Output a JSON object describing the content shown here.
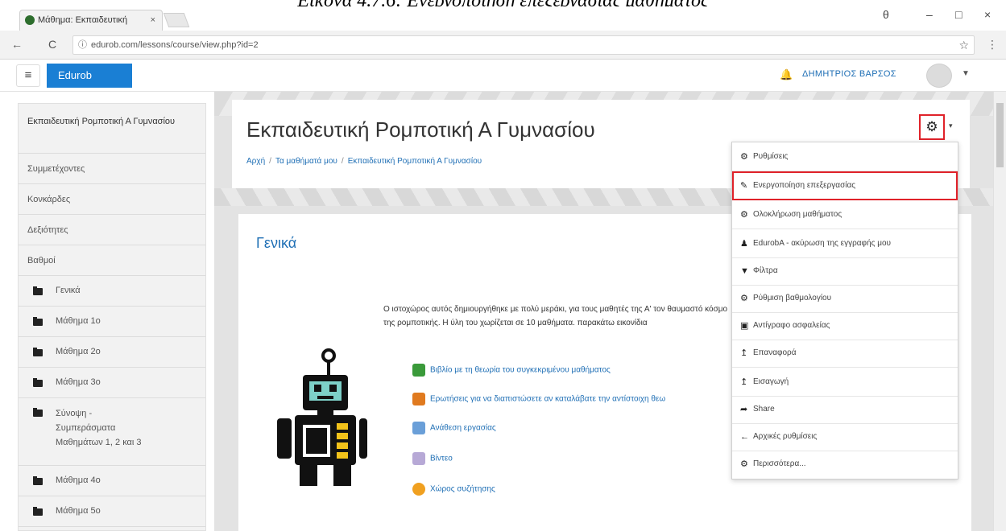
{
  "caption": "Εικόνα 4.7.6: Ενεργοποίηση επεξεργασίας μαθήματος",
  "browser": {
    "tab_title": "Μάθημα: Εκπαιδευτική",
    "tab_close": "×",
    "url": "edurob.com/lessons/course/view.php?id=2",
    "back": "←",
    "reload": "C",
    "info": "ⓘ",
    "star": "☆",
    "menu": "⋮",
    "win_profile": "θ",
    "win_min": "–",
    "win_max": "□",
    "win_close": "×"
  },
  "navbar": {
    "menu_toggle": "≡",
    "brand": "Edurob",
    "bell": "🔔",
    "user_name": "ΔΗΜΗΤΡΙΟΣ ΒΑΡΣΟΣ",
    "user_caret": "▼"
  },
  "drawer": {
    "course_title": "Εκπαιδευτική Ρομποτική Α Γυμνασίου",
    "items": [
      "Συμμετέχοντες",
      "Κονκάρδες",
      "Δεξιότητες",
      "Βαθμοί"
    ],
    "sections": [
      "Γενικά",
      "Μάθημα 1ο",
      "Μάθημα 2ο",
      "Μάθημα 3ο",
      "Σύνοψη - Συμπεράσματα Μαθημάτων 1, 2 και 3",
      "Μάθημα 4ο",
      "Μάθημα 5ο"
    ]
  },
  "header": {
    "title": "Εκπαιδευτική Ρομποτική Α Γυμνασίου",
    "breadcrumb": [
      "Αρχή",
      "Τα μαθήματά μου",
      "Εκπαιδευτική Ρομποτική Α Γυμνασίου"
    ],
    "breadcrumb_sep": "/",
    "gear": "⚙",
    "gear_caret": "▾"
  },
  "section": {
    "title": "Γενικά",
    "intro": "Ο ιστοχώρος αυτός δημιουργήθηκε με πολύ μεράκι, για τους μαθητές της Α' τον θαυμαστό κόσμο της ρομποτικής. Η ύλη του χωρίζεται σε 10 μαθήματα. παρακάτω εικονίδια",
    "activities": [
      {
        "label": "Βιβλίο με τη θεωρία του συγκεκριμένου μαθήματος",
        "color": "#3a9a3a"
      },
      {
        "label": "Ερωτήσεις για να διαπιστώσετε αν καταλάβατε την αντίστοιχη θεω",
        "color": "#e07a1f"
      },
      {
        "label": "Ανάθεση εργασίας",
        "color": "#6a9fd8"
      },
      {
        "label": "Βίντεο",
        "color": "#b7a9d6"
      },
      {
        "label": "Χώρος συζήτησης",
        "color": "#f0a020"
      }
    ]
  },
  "dropdown": [
    {
      "icon": "⚙",
      "label": "Ρυθμίσεις"
    },
    {
      "icon": "✎",
      "label": "Ενεργοποίηση επεξεργασίας"
    },
    {
      "icon": "⚙",
      "label": "Ολοκλήρωση μαθήματος"
    },
    {
      "icon": "♟",
      "label": "EdurobA - ακύρωση της εγγραφής μου"
    },
    {
      "icon": "▼",
      "label": "Φίλτρα"
    },
    {
      "icon": "⚙",
      "label": "Ρύθμιση βαθμολογίου"
    },
    {
      "icon": "▣",
      "label": "Αντίγραφο ασφαλείας"
    },
    {
      "icon": "↥",
      "label": "Επαναφορά"
    },
    {
      "icon": "↥",
      "label": "Εισαγωγή"
    },
    {
      "icon": "➦",
      "label": "Share"
    },
    {
      "icon": "←",
      "label": "Αρχικές ρυθμίσεις"
    },
    {
      "icon": "⚙",
      "label": "Περισσότερα..."
    }
  ],
  "colors": {
    "brand": "#1a7fd4",
    "link": "#1f6fb5",
    "highlight": "#e0222a"
  }
}
